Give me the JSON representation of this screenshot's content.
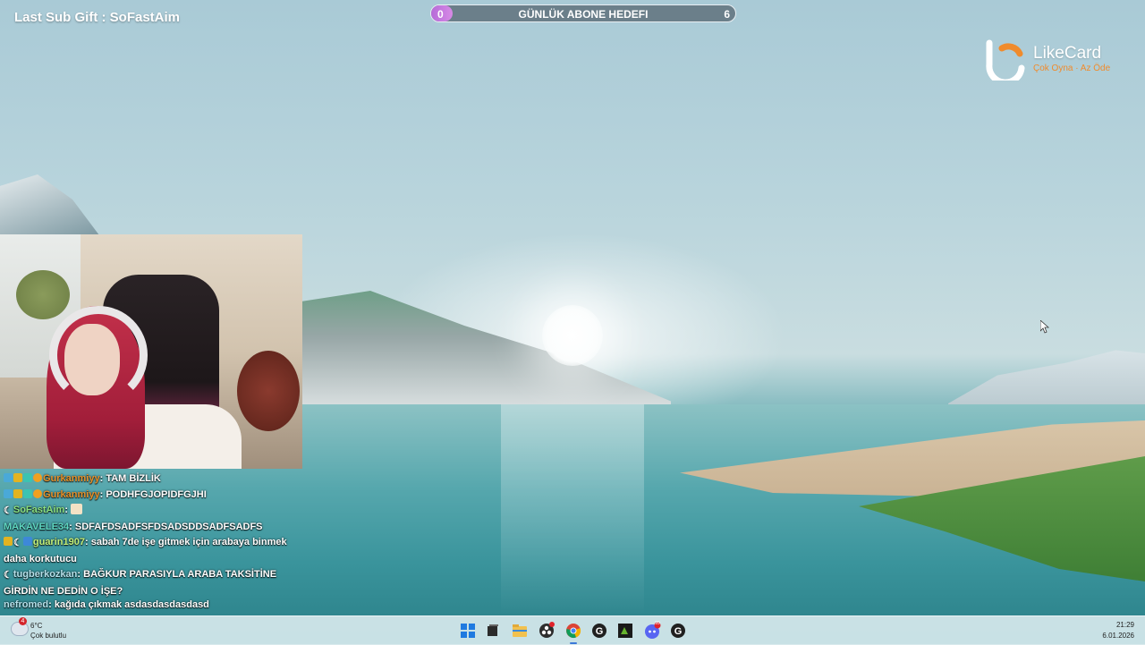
{
  "stream": {
    "last_sub_gift": "Last Sub Gift : SoFastAim"
  },
  "goal": {
    "title": "GÜNLÜK ABONE HEDEFI",
    "current": "0",
    "target": "6",
    "progress_fraction": 0.05
  },
  "sponsor": {
    "name": "LikeCard",
    "tagline": "Çok Oyna · Az Öde",
    "accent_color": "#f08b2c"
  },
  "chat": {
    "messages": [
      {
        "user": "Gurkanmiyy",
        "text": "TAM BİZLİK",
        "user_color": "#e8912a",
        "badges": [
          "sword",
          "crown",
          "gift",
          "one"
        ]
      },
      {
        "user": "Gurkanmiyy",
        "text": "PODHFGJOPIDFGJHI",
        "user_color": "#e8912a",
        "badges": [
          "sword",
          "crown",
          "gift",
          "one"
        ]
      },
      {
        "user": "SoFastAim",
        "text": "",
        "user_color": "#8be07f",
        "badges": [
          "moon"
        ],
        "emote": true
      },
      {
        "user": "MAKAVELE34",
        "text": "SDFAFDSADFSFDSADSDDSADFSADFS",
        "user_color": "#5fd8c3",
        "badges": []
      },
      {
        "user": "guarin1907",
        "text": "sabah 7de işe gitmek için arabaya binmek daha korkutucu",
        "user_color": "#c3f07a",
        "badges": [
          "crown",
          "moon",
          "cube"
        ]
      },
      {
        "user": "tugberkozkan",
        "text": "BAĞKUR PARASIYLA ARABA TAKSİTİNE GİRDİN NE DEDİN O İŞE?",
        "user_color": "#b5e0ea",
        "badges": [
          "moon"
        ]
      },
      {
        "user": "nefromed",
        "text": "kağıda çıkmak asdasdasdasdasd",
        "user_color": "#b5e0ea",
        "badges": []
      }
    ]
  },
  "taskbar": {
    "weather_temp": "6°C",
    "weather_condition": "Çok bulutlu",
    "weather_alert_count": "4",
    "time": "21:29",
    "date": "6.01.2026",
    "apps": [
      {
        "name": "start-icon",
        "color": "#1f7ae0"
      },
      {
        "name": "task-view-icon",
        "color": "#2b2b2b"
      },
      {
        "name": "file-explorer-icon",
        "color": "#f2c14e"
      },
      {
        "name": "obs-icon",
        "color": "#2d2d2d"
      },
      {
        "name": "chrome-icon",
        "color": "#db4437"
      },
      {
        "name": "g-app-icon",
        "color": "#202020"
      },
      {
        "name": "nvidia-icon",
        "color": "#66b32e"
      },
      {
        "name": "discord-icon",
        "color": "#5865f2"
      },
      {
        "name": "g-hub-icon",
        "color": "#202020"
      }
    ],
    "discord_badge": "99"
  }
}
